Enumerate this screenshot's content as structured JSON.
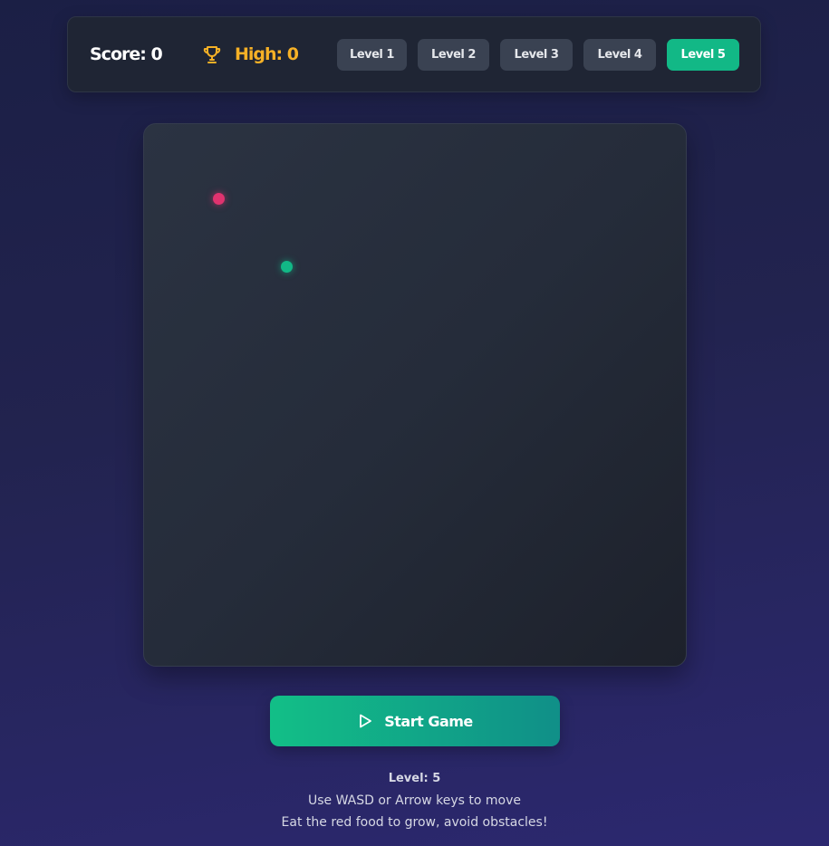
{
  "header": {
    "score_text": "Score: 0",
    "high_text": "High: 0",
    "levels": [
      {
        "label": "Level 1",
        "active": false
      },
      {
        "label": "Level 2",
        "active": false
      },
      {
        "label": "Level 3",
        "active": false
      },
      {
        "label": "Level 4",
        "active": false
      },
      {
        "label": "Level 5",
        "active": true
      }
    ]
  },
  "icons": {
    "trophy": "trophy-icon",
    "play": "play-icon"
  },
  "colors": {
    "accent": "#12b886",
    "high_score": "#f6b126",
    "food": "#e0336f",
    "snake": "#12b886"
  },
  "controls": {
    "start_label": "Start Game"
  },
  "info": {
    "level_text": "Level: 5",
    "instructions": "Use WASD or Arrow keys to move",
    "goal": "Eat the red food to grow, avoid obstacles!"
  }
}
